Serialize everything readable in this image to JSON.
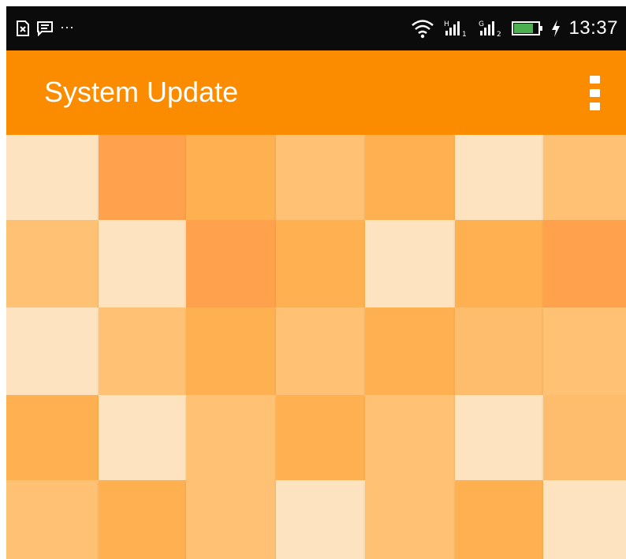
{
  "status_bar": {
    "time": "13:37",
    "left_icons": [
      "sim-icon",
      "message-icon",
      "more-notifications-icon"
    ],
    "more_notifications": "···",
    "right_icons": [
      "wifi-icon",
      "signal-sim1-icon",
      "signal-sim2-icon",
      "battery-icon",
      "charging-icon"
    ]
  },
  "app_bar": {
    "title": "System Update",
    "menu_icon": "overflow-menu-icon"
  },
  "colors": {
    "status_bar": "#0b0b0b",
    "app_bar": "#fb8c00",
    "tile_palette": {
      "a": "#fde3bf",
      "b": "#ffa14d",
      "c": "#ffb152",
      "d": "#ffc274",
      "e": "#fdbd6c"
    }
  },
  "tile_grid": {
    "columns": 7,
    "rows": 5,
    "cells": [
      [
        "a",
        "b",
        "c",
        "d",
        "c",
        "a",
        "d"
      ],
      [
        "d",
        "a",
        "b",
        "c",
        "a",
        "c",
        "b"
      ],
      [
        "a",
        "d",
        "c",
        "d",
        "c",
        "e",
        "d"
      ],
      [
        "c",
        "a",
        "d",
        "c",
        "d",
        "a",
        "e"
      ],
      [
        "d",
        "c",
        "d",
        "a",
        "d",
        "c",
        "a"
      ]
    ]
  }
}
